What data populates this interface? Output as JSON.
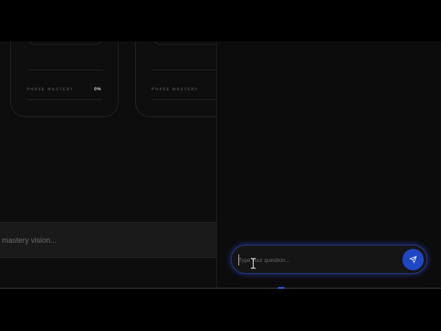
{
  "phase_cards": [
    {
      "mastery_label": "PHASE MASTERY",
      "mastery_value": "0%"
    },
    {
      "mastery_label": "PHASE MASTERY",
      "mastery_value": ""
    }
  ],
  "vision": {
    "text": "r mastery vision..."
  },
  "chat": {
    "placeholder": "Type your question...",
    "value": ""
  },
  "icons": {
    "send": "send-icon",
    "cursor": "text-cursor-icon"
  },
  "colors": {
    "accent": "#1f47c4",
    "glow": "#3050dc",
    "background": "#0c0c0c"
  }
}
